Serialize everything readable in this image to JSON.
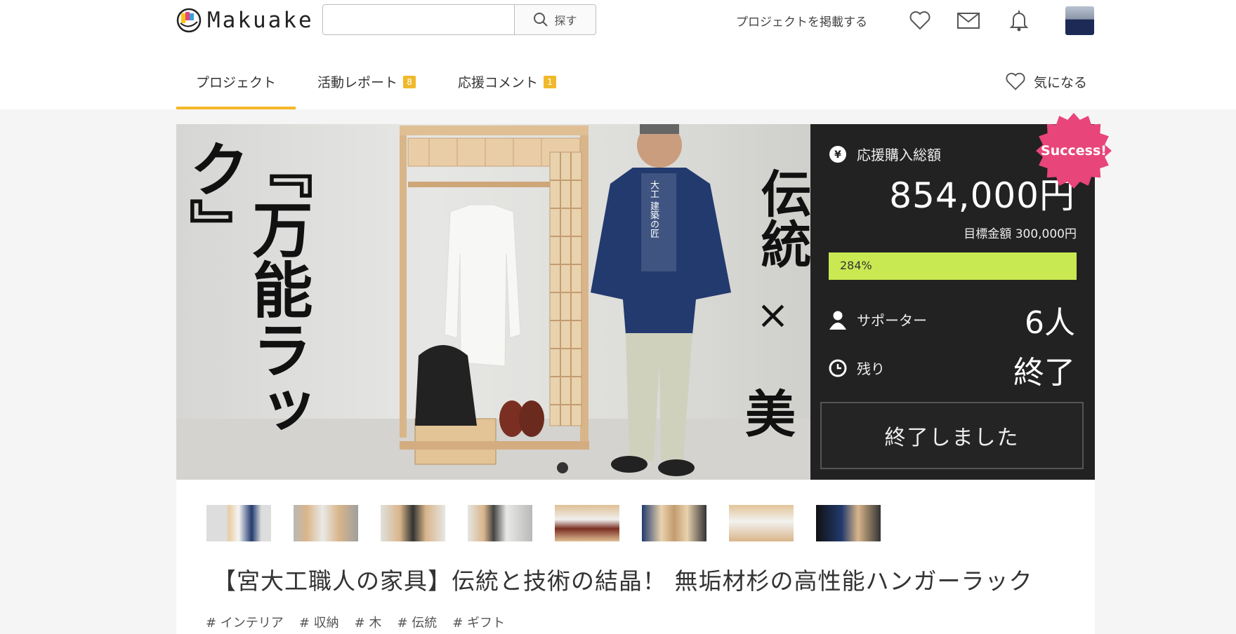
{
  "header": {
    "logo_text": "Makuake",
    "search": {
      "value": "",
      "button_label": "探す"
    },
    "post_project_label": "プロジェクトを掲載する"
  },
  "tabs": [
    {
      "label": "プロジェクト",
      "badge": ""
    },
    {
      "label": "活動レポート",
      "badge": "8"
    },
    {
      "label": "応援コメント",
      "badge": "1"
    }
  ],
  "favorite_label": "気になる",
  "hero": {
    "left_text": "『万能ラック』",
    "right_text_top": "伝統",
    "right_text_mid": "×",
    "right_text_bottom": "美",
    "happi_text": "大工 建築の匠"
  },
  "stats": {
    "total_label": "応援購入総額",
    "total_amount": "854,000円",
    "goal_text": "目標金額 300,000円",
    "progress_text": "284%",
    "progress_percent": 284,
    "supporters_label": "サポーター",
    "supporters_value": "6人",
    "remaining_label": "残り",
    "remaining_value": "終了",
    "ended_button": "終了しました",
    "badge": "Success!"
  },
  "project": {
    "title": "【宮大工職人の家具】伝統と技術の結晶！ 無垢材杉の高性能ハンガーラック",
    "tags": [
      "# インテリア",
      "# 収納",
      "# 木",
      "# 伝統",
      "# ギフト"
    ]
  },
  "thumbnail_count": 8,
  "colors": {
    "accent": "#f5b829",
    "progress": "#c8e952",
    "success_badge": "#e8457a",
    "stats_bg": "#222222"
  }
}
